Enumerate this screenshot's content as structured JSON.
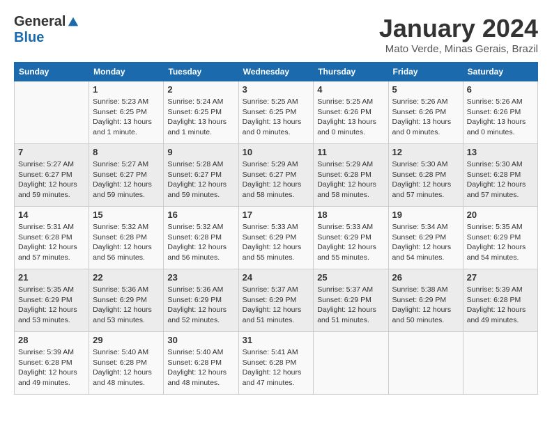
{
  "logo": {
    "general": "General",
    "blue": "Blue"
  },
  "title": "January 2024",
  "location": "Mato Verde, Minas Gerais, Brazil",
  "days_of_week": [
    "Sunday",
    "Monday",
    "Tuesday",
    "Wednesday",
    "Thursday",
    "Friday",
    "Saturday"
  ],
  "weeks": [
    [
      {
        "day": "",
        "info": ""
      },
      {
        "day": "1",
        "info": "Sunrise: 5:23 AM\nSunset: 6:25 PM\nDaylight: 13 hours\nand 1 minute."
      },
      {
        "day": "2",
        "info": "Sunrise: 5:24 AM\nSunset: 6:25 PM\nDaylight: 13 hours\nand 1 minute."
      },
      {
        "day": "3",
        "info": "Sunrise: 5:25 AM\nSunset: 6:25 PM\nDaylight: 13 hours\nand 0 minutes."
      },
      {
        "day": "4",
        "info": "Sunrise: 5:25 AM\nSunset: 6:26 PM\nDaylight: 13 hours\nand 0 minutes."
      },
      {
        "day": "5",
        "info": "Sunrise: 5:26 AM\nSunset: 6:26 PM\nDaylight: 13 hours\nand 0 minutes."
      },
      {
        "day": "6",
        "info": "Sunrise: 5:26 AM\nSunset: 6:26 PM\nDaylight: 13 hours\nand 0 minutes."
      }
    ],
    [
      {
        "day": "7",
        "info": "Sunrise: 5:27 AM\nSunset: 6:27 PM\nDaylight: 12 hours\nand 59 minutes."
      },
      {
        "day": "8",
        "info": "Sunrise: 5:27 AM\nSunset: 6:27 PM\nDaylight: 12 hours\nand 59 minutes."
      },
      {
        "day": "9",
        "info": "Sunrise: 5:28 AM\nSunset: 6:27 PM\nDaylight: 12 hours\nand 59 minutes."
      },
      {
        "day": "10",
        "info": "Sunrise: 5:29 AM\nSunset: 6:27 PM\nDaylight: 12 hours\nand 58 minutes."
      },
      {
        "day": "11",
        "info": "Sunrise: 5:29 AM\nSunset: 6:28 PM\nDaylight: 12 hours\nand 58 minutes."
      },
      {
        "day": "12",
        "info": "Sunrise: 5:30 AM\nSunset: 6:28 PM\nDaylight: 12 hours\nand 57 minutes."
      },
      {
        "day": "13",
        "info": "Sunrise: 5:30 AM\nSunset: 6:28 PM\nDaylight: 12 hours\nand 57 minutes."
      }
    ],
    [
      {
        "day": "14",
        "info": "Sunrise: 5:31 AM\nSunset: 6:28 PM\nDaylight: 12 hours\nand 57 minutes."
      },
      {
        "day": "15",
        "info": "Sunrise: 5:32 AM\nSunset: 6:28 PM\nDaylight: 12 hours\nand 56 minutes."
      },
      {
        "day": "16",
        "info": "Sunrise: 5:32 AM\nSunset: 6:28 PM\nDaylight: 12 hours\nand 56 minutes."
      },
      {
        "day": "17",
        "info": "Sunrise: 5:33 AM\nSunset: 6:29 PM\nDaylight: 12 hours\nand 55 minutes."
      },
      {
        "day": "18",
        "info": "Sunrise: 5:33 AM\nSunset: 6:29 PM\nDaylight: 12 hours\nand 55 minutes."
      },
      {
        "day": "19",
        "info": "Sunrise: 5:34 AM\nSunset: 6:29 PM\nDaylight: 12 hours\nand 54 minutes."
      },
      {
        "day": "20",
        "info": "Sunrise: 5:35 AM\nSunset: 6:29 PM\nDaylight: 12 hours\nand 54 minutes."
      }
    ],
    [
      {
        "day": "21",
        "info": "Sunrise: 5:35 AM\nSunset: 6:29 PM\nDaylight: 12 hours\nand 53 minutes."
      },
      {
        "day": "22",
        "info": "Sunrise: 5:36 AM\nSunset: 6:29 PM\nDaylight: 12 hours\nand 53 minutes."
      },
      {
        "day": "23",
        "info": "Sunrise: 5:36 AM\nSunset: 6:29 PM\nDaylight: 12 hours\nand 52 minutes."
      },
      {
        "day": "24",
        "info": "Sunrise: 5:37 AM\nSunset: 6:29 PM\nDaylight: 12 hours\nand 51 minutes."
      },
      {
        "day": "25",
        "info": "Sunrise: 5:37 AM\nSunset: 6:29 PM\nDaylight: 12 hours\nand 51 minutes."
      },
      {
        "day": "26",
        "info": "Sunrise: 5:38 AM\nSunset: 6:29 PM\nDaylight: 12 hours\nand 50 minutes."
      },
      {
        "day": "27",
        "info": "Sunrise: 5:39 AM\nSunset: 6:28 PM\nDaylight: 12 hours\nand 49 minutes."
      }
    ],
    [
      {
        "day": "28",
        "info": "Sunrise: 5:39 AM\nSunset: 6:28 PM\nDaylight: 12 hours\nand 49 minutes."
      },
      {
        "day": "29",
        "info": "Sunrise: 5:40 AM\nSunset: 6:28 PM\nDaylight: 12 hours\nand 48 minutes."
      },
      {
        "day": "30",
        "info": "Sunrise: 5:40 AM\nSunset: 6:28 PM\nDaylight: 12 hours\nand 48 minutes."
      },
      {
        "day": "31",
        "info": "Sunrise: 5:41 AM\nSunset: 6:28 PM\nDaylight: 12 hours\nand 47 minutes."
      },
      {
        "day": "",
        "info": ""
      },
      {
        "day": "",
        "info": ""
      },
      {
        "day": "",
        "info": ""
      }
    ]
  ]
}
